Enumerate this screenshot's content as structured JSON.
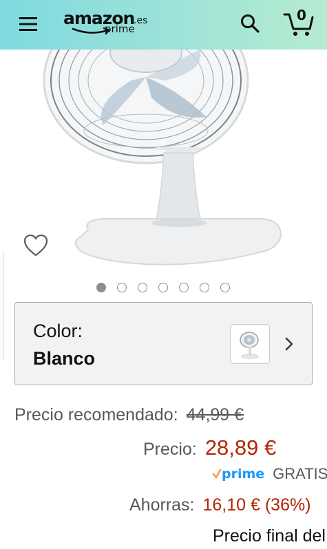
{
  "header": {
    "logo_brand": "amazon",
    "logo_tld": ".es",
    "logo_sub": "prime",
    "cart_count": "0",
    "icons": {
      "menu": "hamburger-menu-icon",
      "search": "search-icon",
      "cart": "cart-icon"
    },
    "gradient_colors": [
      "#7fd9df",
      "#b6ebd0"
    ]
  },
  "product": {
    "image_alt": "Ventilador de mesa blanco",
    "carousel": {
      "total": 7,
      "active_index": 0
    },
    "wishlist_icon": "heart-outline-icon"
  },
  "color_selector": {
    "label": "Color:",
    "value": "Blanco",
    "chevron_icon": "chevron-right-icon"
  },
  "pricing": {
    "list_price_label": "Precio recomendado:",
    "list_price_value": "44,99 €",
    "price_label": "Precio:",
    "price_value": "28,89 €",
    "prime_label": "prime",
    "shipping_text": "GRATIS",
    "savings_label": "Ahorras:",
    "savings_value": "16,10 € (36%)",
    "final_price_text": "Precio final del producto",
    "accent_price_color": "#b12704",
    "prime_color": "#1a98ff",
    "prime_check_color": "#f3a847"
  }
}
